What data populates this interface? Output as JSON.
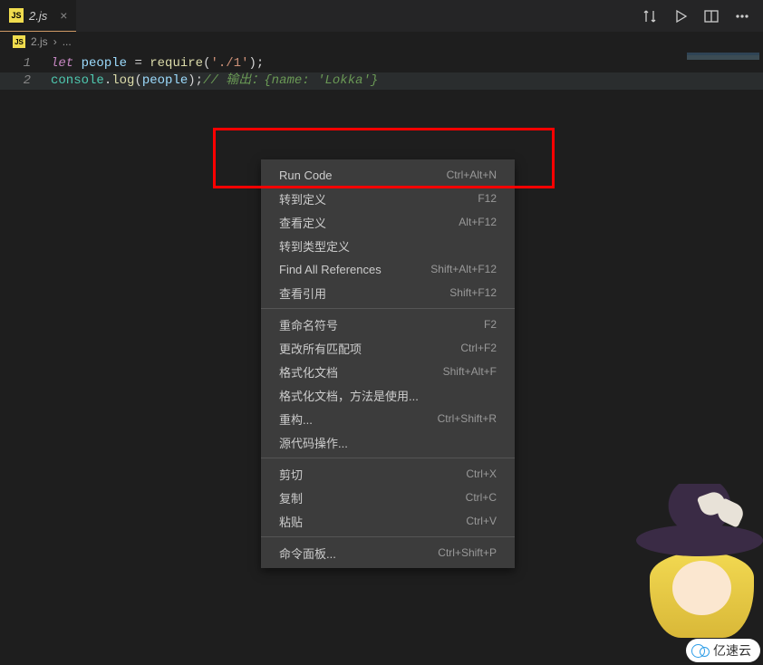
{
  "tab": {
    "icon_text": "JS",
    "filename": "2.js"
  },
  "toolbar": {
    "compare_icon": "compare-icon",
    "run_icon": "play-icon",
    "split_icon": "split-icon",
    "more_icon": "more-icon"
  },
  "breadcrumb": {
    "icon_text": "JS",
    "file": "2.js",
    "separator": "›",
    "detail": "..."
  },
  "code": {
    "lines": [
      {
        "num": "1",
        "tokens": {
          "t1": "let",
          "t2": " people ",
          "t3": "=",
          "t4": " require",
          "t5": "(",
          "t6": "'./1'",
          "t7": ");"
        }
      },
      {
        "num": "2",
        "tokens": {
          "t1": "console",
          "t2": ".",
          "t3": "log",
          "t4": "(",
          "t5": "people",
          "t6": ");",
          "t7": "// 输出：{name: 'Lokka'}"
        }
      }
    ]
  },
  "context_menu": {
    "groups": [
      [
        {
          "label": "Run Code",
          "shortcut": "Ctrl+Alt+N"
        },
        {
          "label": "转到定义",
          "shortcut": "F12"
        },
        {
          "label": "查看定义",
          "shortcut": "Alt+F12"
        },
        {
          "label": "转到类型定义",
          "shortcut": ""
        },
        {
          "label": "Find All References",
          "shortcut": "Shift+Alt+F12"
        },
        {
          "label": "查看引用",
          "shortcut": "Shift+F12"
        }
      ],
      [
        {
          "label": "重命名符号",
          "shortcut": "F2"
        },
        {
          "label": "更改所有匹配项",
          "shortcut": "Ctrl+F2"
        },
        {
          "label": "格式化文档",
          "shortcut": "Shift+Alt+F"
        },
        {
          "label": "格式化文档，方法是使用...",
          "shortcut": ""
        },
        {
          "label": "重构...",
          "shortcut": "Ctrl+Shift+R"
        },
        {
          "label": "源代码操作...",
          "shortcut": ""
        }
      ],
      [
        {
          "label": "剪切",
          "shortcut": "Ctrl+X"
        },
        {
          "label": "复制",
          "shortcut": "Ctrl+C"
        },
        {
          "label": "粘贴",
          "shortcut": "Ctrl+V"
        }
      ],
      [
        {
          "label": "命令面板...",
          "shortcut": "Ctrl+Shift+P"
        }
      ]
    ]
  },
  "watermark": {
    "text": "亿速云"
  },
  "colors": {
    "background": "#1e1e1e",
    "menu_bg": "#3c3c3c",
    "highlight_box": "#ff0000",
    "js_icon": "#f0dc4e"
  }
}
